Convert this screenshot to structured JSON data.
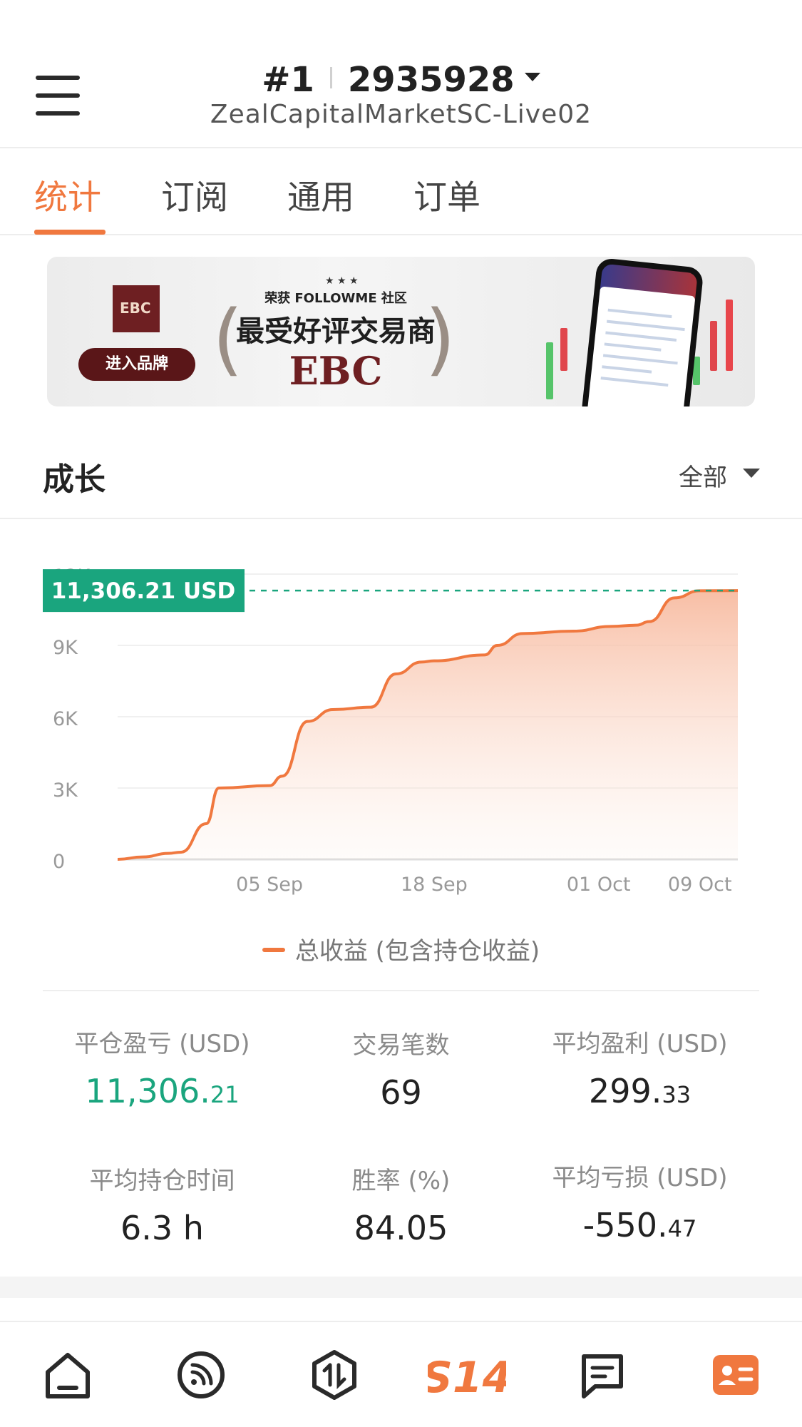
{
  "header": {
    "account_index": "#1",
    "account_number": "2935928",
    "server": "ZealCapitalMarketSC-Live02"
  },
  "tabs": [
    {
      "label": "统计",
      "active": true
    },
    {
      "label": "订阅",
      "active": false
    },
    {
      "label": "通用",
      "active": false
    },
    {
      "label": "订单",
      "active": false
    }
  ],
  "banner": {
    "logo_text": "EBC FINANCIAL GROUP",
    "cta": "进入品牌",
    "award_line": "荣获 FOLLOWME 社区",
    "award_title": "最受好评交易商",
    "brand": "EBC"
  },
  "growth": {
    "title": "成长",
    "range": "全部"
  },
  "chart_data": {
    "type": "area",
    "y_ticks": [
      "0",
      "3K",
      "6K",
      "9K",
      "12K"
    ],
    "x_ticks": [
      "05 Sep",
      "18 Sep",
      "01 Oct",
      "09 Oct"
    ],
    "current_label": "11,306.21 USD",
    "current_value": 11306.21,
    "ylim": [
      0,
      12000
    ],
    "series": [
      {
        "name": "总收益 (包含持仓收益)",
        "x": [
          "2022-08-24",
          "2022-08-26",
          "2022-08-28",
          "2022-08-29",
          "2022-08-31",
          "2022-09-01",
          "2022-09-05",
          "2022-09-06",
          "2022-09-08",
          "2022-09-10",
          "2022-09-13",
          "2022-09-15",
          "2022-09-17",
          "2022-09-18",
          "2022-09-22",
          "2022-09-23",
          "2022-09-25",
          "2022-09-29",
          "2022-10-02",
          "2022-10-04",
          "2022-10-05",
          "2022-10-07",
          "2022-10-09",
          "2022-10-12"
        ],
        "values": [
          0,
          100,
          250,
          300,
          1500,
          3000,
          3100,
          3500,
          5800,
          6300,
          6400,
          7800,
          8300,
          8350,
          8600,
          9000,
          9500,
          9600,
          9800,
          9850,
          10000,
          11000,
          11300,
          11306.21
        ]
      }
    ],
    "grid": true,
    "legend": "bottom-center",
    "colors": {
      "line": "#f0783f",
      "marker": "#1aa57e"
    }
  },
  "legend_label": "总收益 (包含持仓收益)",
  "stats": {
    "closed_pl": {
      "label": "平仓盈亏 (USD)",
      "int": "11,306.",
      "dec": "21"
    },
    "trades": {
      "label": "交易笔数",
      "value": "69"
    },
    "avg_profit": {
      "label": "平均盈利 (USD)",
      "int": "299.",
      "dec": "33"
    },
    "avg_hold": {
      "label": "平均持仓时间",
      "value": "6.3 h"
    },
    "win_rate": {
      "label": "胜率 (%)",
      "value": "84.05"
    },
    "avg_loss": {
      "label": "平均亏损 (USD)",
      "int": "-550.",
      "dec": "47"
    }
  },
  "nav": {
    "icons": [
      "home-icon",
      "feed-icon",
      "trade-icon",
      "s14-logo-icon",
      "message-icon",
      "profile-card-icon"
    ],
    "center_text": "S14",
    "accent": "#f0783f"
  }
}
